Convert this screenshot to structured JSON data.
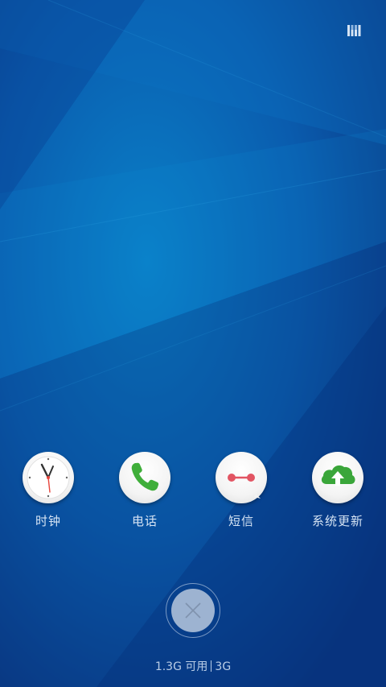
{
  "apps": [
    {
      "label": "时钟",
      "icon": "clock-icon"
    },
    {
      "label": "电话",
      "icon": "phone-icon"
    },
    {
      "label": "短信",
      "icon": "messages-icon"
    },
    {
      "label": "系统更新",
      "icon": "system-update-icon"
    }
  ],
  "memory": {
    "available": "1.3G 可用",
    "total": "3G"
  },
  "colors": {
    "wallpaper_light": "#0a7fc6",
    "wallpaper_dark": "#0a3a86",
    "label_text": "#d6e4f4",
    "close_button": "#bccde2",
    "phone_green": "#3fae3a",
    "message_red": "#e25563",
    "update_green": "#3aa63a"
  },
  "icons": {
    "status": "memory-bars-icon",
    "close": "close-icon"
  }
}
